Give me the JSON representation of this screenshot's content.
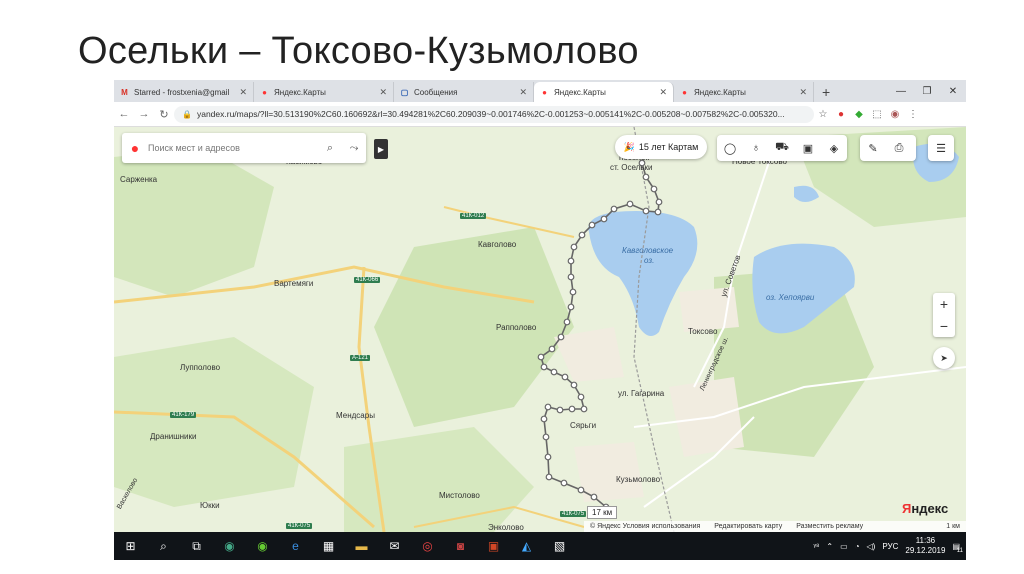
{
  "slide": {
    "title": "Осельки – Токсово-Кузьмолово"
  },
  "browser": {
    "tabs": [
      {
        "label": "Starred - frostxenia@gmail",
        "icon": "gmail-icon",
        "icon_glyph": "M",
        "icon_color": "#d93025"
      },
      {
        "label": "Яндекс.Карты",
        "icon": "yandex-maps-pin-icon",
        "icon_glyph": "●",
        "icon_color": "#f33"
      },
      {
        "label": "Сообщения",
        "icon": "messages-icon",
        "icon_glyph": "▢",
        "icon_color": "#2a5db0"
      },
      {
        "label": "Яндекс.Карты",
        "icon": "yandex-maps-pin-icon",
        "icon_glyph": "●",
        "icon_color": "#f33",
        "active": true
      },
      {
        "label": "Яндекс.Карты",
        "icon": "yandex-maps-pin-icon",
        "icon_glyph": "●",
        "icon_color": "#f33"
      }
    ],
    "new_tab": "+",
    "url": "yandex.ru/maps/?ll=30.513190%2C60.160692&rl=30.494281%2C60.209039~0.001746%2C-0.001253~0.005141%2C-0.005208~0.007582%2C-0.005320..."
  },
  "map": {
    "search_placeholder": "Поиск мест и адресов",
    "promo": "15 лет Картам",
    "labels": {
      "saryenka": "Сарженка",
      "kasimovo": "Касимово",
      "oselki_village": "посёлок",
      "oselki_station": "ст. Осельки",
      "novoe_toksovo": "Новое Токсово",
      "kavgolovo": "Кавголово",
      "kavgolovskoe_lake": "Кавголовское",
      "kavgolovskoe_lake2": "оз.",
      "vartemyagi": "Вартемяги",
      "rappolovo": "Рапполово",
      "toksovo": "Токсово",
      "lake_hepoyarvi": "оз. Хепоярви",
      "ul_sovetov": "ул. Советов",
      "leningradskoe_sh": "Ленинградское ш.",
      "ul_gagarina": "ул. Гагарина",
      "lupполово": "Лупполово",
      "mendsary": "Мендсары",
      "syargi": "Сярьги",
      "dranishniki": "Дранишники",
      "kuzmolovo": "Кузьмолово",
      "mistolovo": "Мистолово",
      "yukki": "Юкки",
      "enkolovo": "Энколово",
      "vaskelovo": "Васкелово"
    },
    "road_tags": [
      "41К-012",
      "41К-066",
      "А-121",
      "41К-179",
      "41К-075",
      "41К-075"
    ],
    "distance": "17 км",
    "brand": "Яндекс",
    "footer": {
      "copyright": "© Яндекс Условия использования",
      "edit": "Редактировать карту",
      "ads": "Разместить рекламу",
      "scale": "1 км"
    },
    "route_color": "#666666",
    "water_color": "#a9cdef"
  },
  "taskbar": {
    "lang": "РУС",
    "time": "11:36",
    "date": "29.12.2019",
    "notifications": "11"
  }
}
